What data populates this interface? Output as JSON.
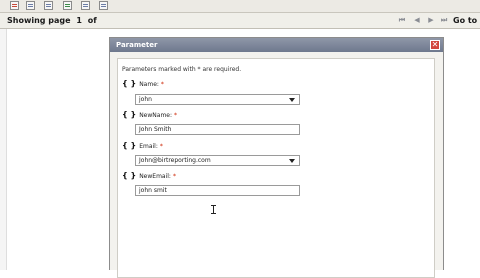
{
  "toolbar": {
    "icons": [
      "report-icon",
      "toc-icon",
      "export-icon",
      "export-data-icon",
      "print-icon",
      "print-server-icon"
    ]
  },
  "navbar": {
    "showing_label": "Showing page",
    "page_number": "1",
    "of_label": "of",
    "goto_label": "Go to"
  },
  "dialog": {
    "title": "Parameter",
    "close_glyph": "✕",
    "note": "Parameters marked with * are required.",
    "params": [
      {
        "label": "Name:",
        "required": "*",
        "value": "john",
        "type": "select"
      },
      {
        "label": "NewName:",
        "required": "*",
        "value": "John Smith",
        "type": "text"
      },
      {
        "label": "Email:",
        "required": "*",
        "value": "John@birtreporting.com",
        "type": "select"
      },
      {
        "label": "NewEmail:",
        "required": "*",
        "value": "john smit",
        "type": "text"
      }
    ]
  }
}
